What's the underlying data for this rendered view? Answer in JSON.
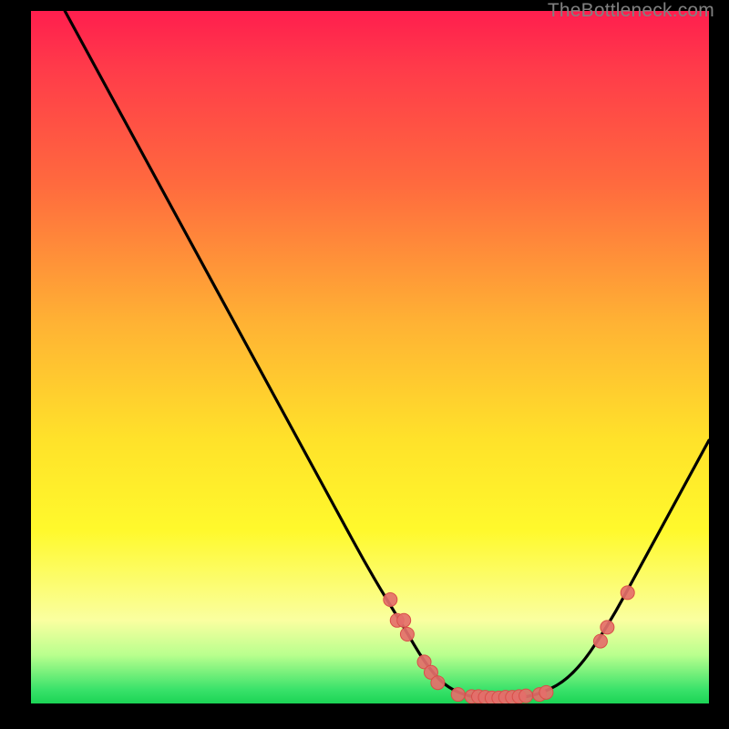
{
  "attribution": "TheBottleneck.com",
  "colors": {
    "curve": "#000000",
    "marker_fill": "#e46f6a",
    "marker_stroke": "#d94e49"
  },
  "chart_data": {
    "type": "line",
    "title": "",
    "xlabel": "",
    "ylabel": "",
    "xlim": [
      0,
      100
    ],
    "ylim": [
      0,
      100
    ],
    "curve": [
      {
        "x": 5,
        "y": 100
      },
      {
        "x": 10,
        "y": 91
      },
      {
        "x": 15,
        "y": 82
      },
      {
        "x": 20,
        "y": 73
      },
      {
        "x": 25,
        "y": 64
      },
      {
        "x": 30,
        "y": 55
      },
      {
        "x": 35,
        "y": 46
      },
      {
        "x": 40,
        "y": 37
      },
      {
        "x": 45,
        "y": 28
      },
      {
        "x": 50,
        "y": 19
      },
      {
        "x": 55,
        "y": 11
      },
      {
        "x": 58,
        "y": 6
      },
      {
        "x": 61,
        "y": 2.5
      },
      {
        "x": 65,
        "y": 0.8
      },
      {
        "x": 70,
        "y": 0.6
      },
      {
        "x": 75,
        "y": 1.2
      },
      {
        "x": 80,
        "y": 4
      },
      {
        "x": 85,
        "y": 11
      },
      {
        "x": 90,
        "y": 20
      },
      {
        "x": 95,
        "y": 29
      },
      {
        "x": 100,
        "y": 38
      }
    ],
    "markers": [
      {
        "x": 53,
        "y": 15
      },
      {
        "x": 54,
        "y": 12
      },
      {
        "x": 55,
        "y": 12
      },
      {
        "x": 55.5,
        "y": 10
      },
      {
        "x": 58,
        "y": 6
      },
      {
        "x": 59,
        "y": 4.5
      },
      {
        "x": 60,
        "y": 3
      },
      {
        "x": 63,
        "y": 1.3
      },
      {
        "x": 65,
        "y": 1.0
      },
      {
        "x": 66,
        "y": 1.0
      },
      {
        "x": 67,
        "y": 0.9
      },
      {
        "x": 68,
        "y": 0.8
      },
      {
        "x": 69,
        "y": 0.8
      },
      {
        "x": 70,
        "y": 0.9
      },
      {
        "x": 71,
        "y": 0.9
      },
      {
        "x": 72,
        "y": 1.0
      },
      {
        "x": 73,
        "y": 1.1
      },
      {
        "x": 75,
        "y": 1.3
      },
      {
        "x": 76,
        "y": 1.6
      },
      {
        "x": 84,
        "y": 9
      },
      {
        "x": 85,
        "y": 11
      },
      {
        "x": 88,
        "y": 16
      }
    ]
  }
}
